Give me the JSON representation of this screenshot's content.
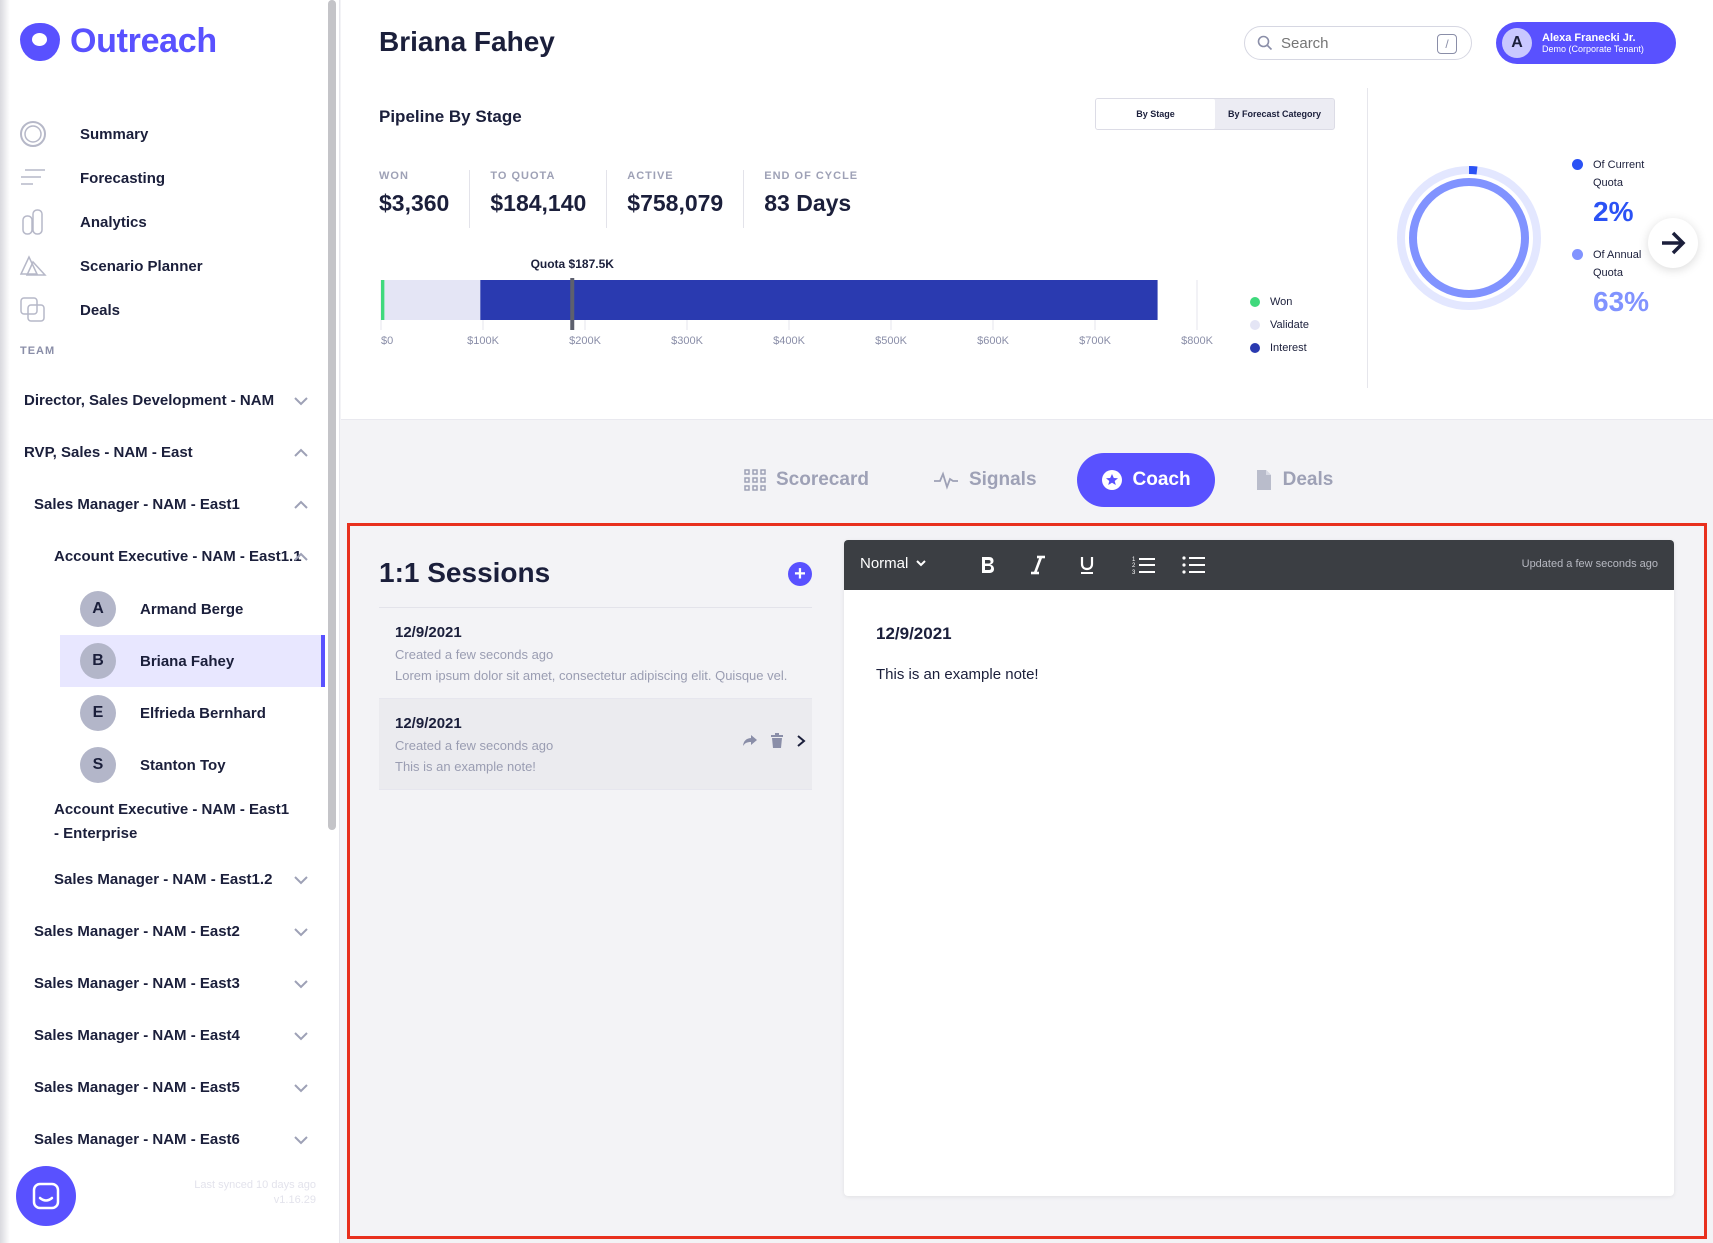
{
  "brand": {
    "name": "Outreach",
    "color": "#5951ff"
  },
  "nav": [
    {
      "label": "Summary",
      "icon": "summary-icon"
    },
    {
      "label": "Forecasting",
      "icon": "forecasting-icon"
    },
    {
      "label": "Analytics",
      "icon": "analytics-icon"
    },
    {
      "label": "Scenario Planner",
      "icon": "scenario-planner-icon"
    },
    {
      "label": "Deals",
      "icon": "deals-icon"
    }
  ],
  "team": {
    "label": "TEAM",
    "groups": [
      {
        "label": "Director, Sales Development - NAM",
        "expanded": false
      },
      {
        "label": "RVP, Sales - NAM - East",
        "expanded": true
      },
      {
        "label": "Sales Manager - NAM - East1",
        "expanded": true
      },
      {
        "label": "Account Executive - NAM - East1.1",
        "expanded": true
      },
      {
        "label": "Account Executive - NAM - East1 - Enterprise",
        "expanded": false
      },
      {
        "label": "Sales Manager - NAM - East1.2",
        "expanded": false
      },
      {
        "label": "Sales Manager - NAM - East2",
        "expanded": false
      },
      {
        "label": "Sales Manager - NAM - East3",
        "expanded": false
      },
      {
        "label": "Sales Manager - NAM - East4",
        "expanded": false
      },
      {
        "label": "Sales Manager - NAM - East5",
        "expanded": false
      },
      {
        "label": "Sales Manager - NAM - East6",
        "expanded": false
      }
    ],
    "people": [
      {
        "initial": "A",
        "name": "Armand Berge"
      },
      {
        "initial": "B",
        "name": "Briana Fahey",
        "selected": true
      },
      {
        "initial": "E",
        "name": "Elfrieda Bernhard"
      },
      {
        "initial": "S",
        "name": "Stanton Toy"
      }
    ]
  },
  "sync": {
    "last_synced": "Last synced 10 days ago",
    "version": "v1.16.29"
  },
  "header": {
    "title": "Briana Fahey",
    "search_placeholder": "Search",
    "search_shortcut": "/",
    "user": {
      "initial": "A",
      "name": "Alexa Franecki Jr.",
      "tenant": "Demo (Corporate Tenant)"
    }
  },
  "pipeline": {
    "title": "Pipeline By Stage",
    "toggle": [
      "By Stage",
      "By Forecast Category"
    ],
    "stats": [
      {
        "label": "WON",
        "value": "$3,360"
      },
      {
        "label": "TO QUOTA",
        "value": "$184,140"
      },
      {
        "label": "ACTIVE",
        "value": "$758,079"
      },
      {
        "label": "END OF CYCLE",
        "value": "83 Days"
      }
    ],
    "quota_label": "Quota $187.5K",
    "legend": [
      {
        "label": "Won",
        "color": "#3fd97c"
      },
      {
        "label": "Validate",
        "color": "#e4e5f5"
      },
      {
        "label": "Interest",
        "color": "#2a3ab0"
      }
    ],
    "quota": {
      "current_label": "Of Current Quota",
      "current_value": "2%",
      "current_color": "#2b52f5",
      "annual_label": "Of Annual Quota",
      "annual_value": "63%",
      "annual_color": "#8193ff"
    }
  },
  "chart_data": {
    "type": "bar",
    "orientation": "horizontal-stacked",
    "title": "",
    "series": [
      {
        "name": "Won",
        "value": 3360,
        "color": "#3fd97c"
      },
      {
        "name": "Validate",
        "value": 94000,
        "color": "#e4e5f5"
      },
      {
        "name": "Interest",
        "value": 664000,
        "color": "#2a3ab0"
      }
    ],
    "xticks": [
      "$0",
      "$100K",
      "$200K",
      "$300K",
      "$400K",
      "$500K",
      "$600K",
      "$700K",
      "$800K"
    ],
    "xlim": [
      0,
      800000
    ],
    "quota_marker": 187500
  },
  "tabs": [
    {
      "label": "Scorecard",
      "icon": "scorecard-icon",
      "active": false
    },
    {
      "label": "Signals",
      "icon": "signals-icon",
      "active": false
    },
    {
      "label": "Coach",
      "icon": "coach-icon",
      "active": true
    },
    {
      "label": "Deals",
      "icon": "deals-doc-icon",
      "active": false
    }
  ],
  "sessions": {
    "title": "1:1 Sessions",
    "add_label": "+",
    "items": [
      {
        "date": "12/9/2021",
        "created": "Created a few seconds ago",
        "preview": "Lorem ipsum dolor sit amet, consectetur adipiscing elit. Quisque vel."
      },
      {
        "date": "12/9/2021",
        "created": "Created a few seconds ago",
        "preview": "This is an example note!"
      }
    ]
  },
  "editor": {
    "format": "Normal",
    "updated": "Updated a few seconds ago",
    "note_title": "12/9/2021",
    "note_text": "This is an example note!"
  }
}
